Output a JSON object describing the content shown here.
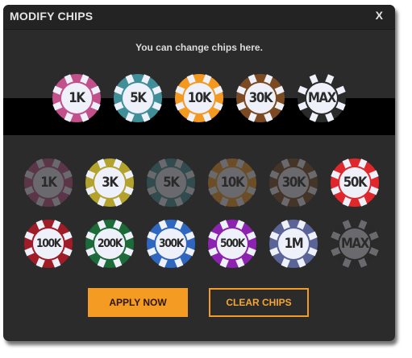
{
  "dialog": {
    "title": "MODIFY CHIPS",
    "close_label": "X",
    "subtitle": "You can change chips here."
  },
  "selected_chips": [
    {
      "label": "1K",
      "color": "#c2508a"
    },
    {
      "label": "5K",
      "color": "#3f8e98"
    },
    {
      "label": "10K",
      "color": "#f3991f"
    },
    {
      "label": "30K",
      "color": "#7b4a22"
    },
    {
      "label": "MAX",
      "color": "#2a2a2a"
    }
  ],
  "available_chips": [
    {
      "label": "1K",
      "color": "#c2508a",
      "dimmed": true
    },
    {
      "label": "3K",
      "color": "#b3a22c",
      "dimmed": false
    },
    {
      "label": "5K",
      "color": "#3f8e98",
      "dimmed": true
    },
    {
      "label": "10K",
      "color": "#f3991f",
      "dimmed": true
    },
    {
      "label": "30K",
      "color": "#7b4a22",
      "dimmed": true
    },
    {
      "label": "50K",
      "color": "#e0282c",
      "dimmed": false
    },
    {
      "label": "100K",
      "color": "#a01c27",
      "dimmed": false
    },
    {
      "label": "200K",
      "color": "#1c6b38",
      "dimmed": false
    },
    {
      "label": "300K",
      "color": "#2f66bf",
      "dimmed": false
    },
    {
      "label": "500K",
      "color": "#8b23b0",
      "dimmed": false
    },
    {
      "label": "1M",
      "color": "#5a6496",
      "dimmed": false
    },
    {
      "label": "MAX",
      "color": "#2a2a2a",
      "dimmed": true
    }
  ],
  "buttons": {
    "apply": "APPLY NOW",
    "clear": "CLEAR CHIPS"
  },
  "colors": {
    "accent": "#f39b22",
    "panel": "#2b2b2b",
    "chip_face": "#eef0fa"
  }
}
